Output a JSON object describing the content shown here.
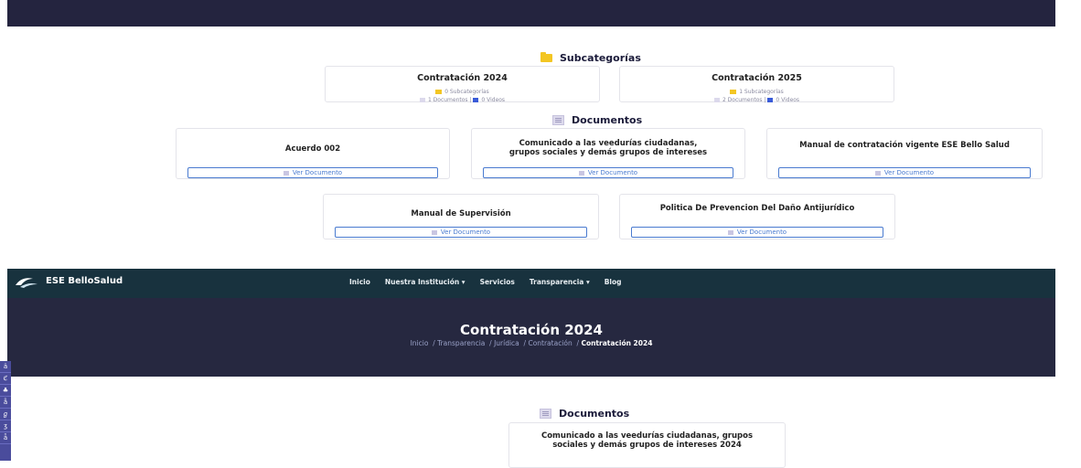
{
  "section1": {
    "subcategories_title": "Subcategorías",
    "subcards": [
      {
        "title": "Contratación 2024",
        "subcats": "0 Subcategorías",
        "docs": "1 Documentos",
        "videos": "0 Videos"
      },
      {
        "title": "Contratación 2025",
        "subcats": "1 Subcategorías",
        "docs": "2 Documentos",
        "videos": "0 Videos"
      }
    ],
    "documents_title": "Documentos",
    "docs": [
      {
        "title": "Acuerdo 002",
        "button": "Ver Documento"
      },
      {
        "title": "Comunicado a las veedurías ciudadanas, grupos sociales y demás grupos de intereses",
        "button": "Ver Documento"
      },
      {
        "title": "Manual de contratación vigente ESE Bello Salud",
        "button": "Ver Documento"
      },
      {
        "title": "Manual de Supervisión",
        "button": "Ver Documento"
      },
      {
        "title": "Politica De Prevencion Del Daño Antijurídico",
        "button": "Ver Documento"
      }
    ]
  },
  "navbar": {
    "brand": "ESE BelloSalud",
    "items": [
      "Inicio",
      "Nuestra Institución ▾",
      "Servicios",
      "Transparencia ▾",
      "Blog"
    ]
  },
  "hero": {
    "title": "Contratación 2024",
    "breadcrumb": [
      "Inicio",
      "Transparencia",
      "Jurídica",
      "Contratación"
    ],
    "current": "Contratación 2024"
  },
  "section2": {
    "documents_title": "Documentos",
    "doc_title": "Comunicado a las veedurías ciudadanas, grupos sociales y demás grupos de intereses 2024"
  },
  "sidebar_tools": [
    "ä",
    "ℭ",
    "♣",
    "ẵ",
    "ℊ",
    "ʒ",
    "ǟ"
  ]
}
